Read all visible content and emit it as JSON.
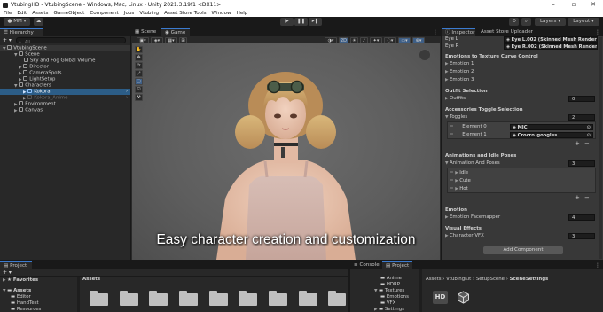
{
  "window": {
    "title": "VtubingHD - VtubingScene - Windows, Mac, Linux - Unity 2021.3.19f1 <DX11>"
  },
  "menu": [
    "File",
    "Edit",
    "Assets",
    "GameObject",
    "Component",
    "Jobs",
    "Vtubing",
    "Asset Store Tools",
    "Window",
    "Help"
  ],
  "toolbar": {
    "account": "MM",
    "layers": "Layers",
    "layout": "Layout"
  },
  "hierarchy": {
    "tab": "Hierarchy",
    "search_placeholder": "All",
    "scene": "VtubingScene",
    "items": [
      {
        "label": "Scene"
      },
      {
        "label": "Sky and Fog Global Volume"
      },
      {
        "label": "Director"
      },
      {
        "label": "CameraSpots"
      },
      {
        "label": "LightSetup"
      },
      {
        "label": "Characters"
      },
      {
        "label": "Kokora"
      },
      {
        "label": "Kokora_Anime"
      },
      {
        "label": "Environment"
      },
      {
        "label": "Canvas"
      }
    ]
  },
  "scene_tabs": {
    "scene": "Scene",
    "game": "Game"
  },
  "scene_toolbar": {
    "mode_2d": "2D"
  },
  "viewport": {
    "subtitle": "Easy character creation and customization"
  },
  "inspector": {
    "tabs": {
      "inspector": "Inspector",
      "asset_store": "Asset Store Uploader"
    },
    "eye_l": {
      "label": "Eye L",
      "value": "Eye L.002 (Skinned Mesh Render"
    },
    "eye_r": {
      "label": "Eye R",
      "value": "Eye R.002 (Skinned Mesh Render"
    },
    "emotions_header": "Emotions to Texture Curve Control",
    "emotions": [
      "Emotion 1",
      "Emotion 2",
      "Emotion 3"
    ],
    "outfit_header": "Outfit Selection",
    "outfits": {
      "label": "Outfits",
      "value": "0"
    },
    "accessories_header": "Accessories Toggle Selection",
    "toggles": {
      "label": "Toggles",
      "value": "2"
    },
    "elements": [
      {
        "label": "Element 0",
        "value": "MIC"
      },
      {
        "label": "Element 1",
        "value": "Crocro_googles"
      }
    ],
    "animations_header": "Animations and Idle Poses",
    "anim_poses": {
      "label": "Animation And Poses",
      "value": "3"
    },
    "poses": [
      "Idle",
      "Cute",
      "Hot"
    ],
    "emotion_header": "Emotion",
    "facemapper": {
      "label": "Emotion Facemapper",
      "value": "4"
    },
    "visual_header": "Visual Effects",
    "vfx": {
      "label": "Character VFX",
      "value": "3"
    },
    "add_component": "Add Component"
  },
  "project": {
    "tab": "Project",
    "favorites": "Favorites",
    "assets_header": "Assets",
    "tree": [
      "Assets",
      "Editor",
      "HandTest",
      "Resources"
    ]
  },
  "console": {
    "tabs": {
      "console": "Console",
      "project": "Project"
    },
    "tree": [
      "Anime",
      "HDRP",
      "Textures",
      "Emotions",
      "VFX",
      "Settings"
    ],
    "breadcrumb": [
      "Assets",
      "VtubingKit",
      "SetupScene",
      "SceneSettings"
    ],
    "thumb_hd": "HD"
  }
}
